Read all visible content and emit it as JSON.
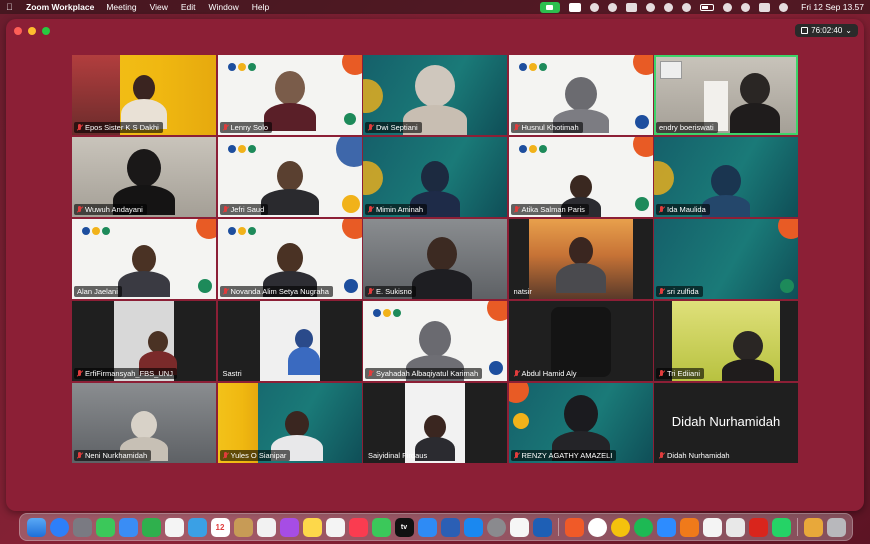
{
  "menubar": {
    "app_name": "Zoom Workplace",
    "menus": [
      "Meeting",
      "View",
      "Edit",
      "Window",
      "Help"
    ],
    "clock": "Fri 12 Sep  13.57"
  },
  "window": {
    "timer": "76:02:40",
    "timer_chevron": "⌄"
  },
  "participants": [
    {
      "name": "Epos Sister K S Dakhi",
      "muted": true,
      "bg": "yellow"
    },
    {
      "name": "Lenny Solo",
      "muted": true,
      "bg": "white"
    },
    {
      "name": "Dwi Septiani",
      "muted": true,
      "bg": "teal"
    },
    {
      "name": "Husnul Khotimah",
      "muted": true,
      "bg": "white"
    },
    {
      "name": "endry boeriswati",
      "muted": false,
      "bg": "room",
      "active": true
    },
    {
      "name": "Wuwuh Andayani",
      "muted": true,
      "bg": "room"
    },
    {
      "name": "Jefri Saud",
      "muted": true,
      "bg": "white"
    },
    {
      "name": "Mimin Aminah",
      "muted": true,
      "bg": "teal"
    },
    {
      "name": "Atika Salman Paris",
      "muted": true,
      "bg": "white"
    },
    {
      "name": "Ida Maulida",
      "muted": true,
      "bg": "teal"
    },
    {
      "name": "Alan Jaelani",
      "muted": false,
      "bg": "white"
    },
    {
      "name": "Novanda Alim Setya Nugraha",
      "muted": true,
      "bg": "white"
    },
    {
      "name": "E. Sukisno",
      "muted": true,
      "bg": "office"
    },
    {
      "name": "natsir",
      "muted": false,
      "bg": "sunset"
    },
    {
      "name": "sri zulfida",
      "muted": true,
      "bg": "teal"
    },
    {
      "name": "ErfiFirmansyah_FBS_UNJ",
      "muted": true,
      "bg": "dark"
    },
    {
      "name": "Sastri",
      "muted": false,
      "bg": "dark"
    },
    {
      "name": "Syahadah Albaqiyatul Karimah",
      "muted": true,
      "bg": "white"
    },
    {
      "name": "Abdul Hamid Aly",
      "muted": true,
      "bg": "dark"
    },
    {
      "name": "Tri Ediiani",
      "muted": true,
      "bg": "green"
    },
    {
      "name": "Neni Nurkhamidah",
      "muted": true,
      "bg": "office"
    },
    {
      "name": "Yules O Sianipar",
      "muted": true,
      "bg": "teal"
    },
    {
      "name": "Saiyidinal Firdaus",
      "muted": false,
      "bg": "dark"
    },
    {
      "name": "RENZY AGATHY AMAZELI",
      "muted": true,
      "bg": "teal"
    },
    {
      "name": "Didah Nurhamidah",
      "muted": true,
      "bg": "dark",
      "video_off": true,
      "display_name": "Didah Nurhamidah"
    }
  ],
  "dock": {
    "calendar_day": "12",
    "app_store_text": "tv"
  },
  "colors": {
    "desktop_bg": "#8a2236",
    "window_bg": "#8c1f36",
    "active_speaker": "#3ed36a",
    "muted_icon": "#e03c3c"
  }
}
